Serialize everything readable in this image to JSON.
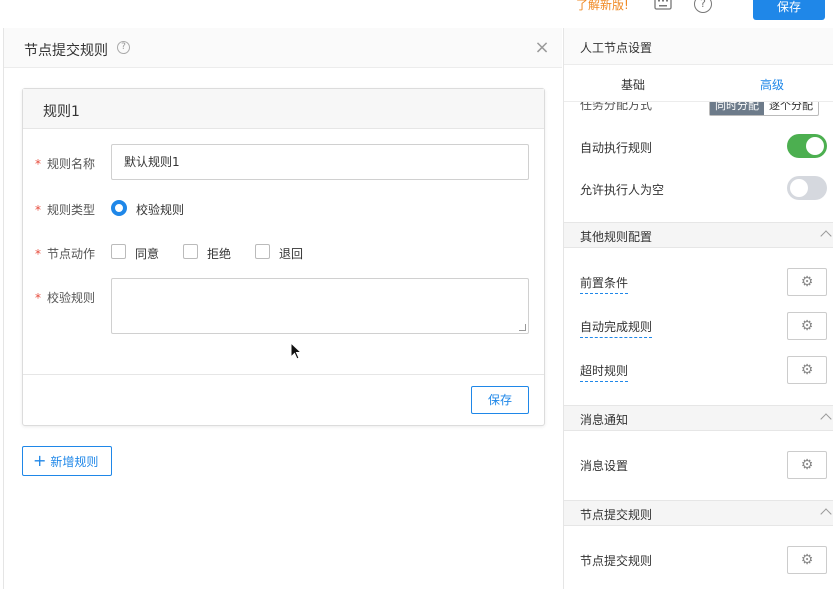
{
  "topbar": {
    "whats_new": "了解新版!",
    "save_label": "保存"
  },
  "dialog": {
    "title": "节点提交规则",
    "rule_card": {
      "title": "规则1",
      "fields": {
        "name_label": "规则名称",
        "name_value": "默认规则1",
        "type_label": "规则类型",
        "type_option": "校验规则",
        "action_label": "节点动作",
        "actions": [
          "同意",
          "拒绝",
          "退回"
        ],
        "check_label": "校验规则",
        "check_value": ""
      },
      "save_label": "保存"
    },
    "add_rule_label": "新增规则"
  },
  "right_panel": {
    "title": "人工节点设置",
    "tabs": [
      "基础",
      "高级"
    ],
    "active_tab": "高级",
    "partial_row": {
      "label": "任务分配方式",
      "options": [
        "同时分配",
        "逐个分配"
      ]
    },
    "toggles": [
      {
        "label": "自动执行规则",
        "on": true
      },
      {
        "label": "允许执行人为空",
        "on": false
      }
    ],
    "sections": [
      {
        "title": "其他规则配置",
        "items": [
          "前置条件",
          "自动完成规则",
          "超时规则"
        ]
      },
      {
        "title": "消息通知",
        "items": [
          "消息设置"
        ]
      },
      {
        "title": "节点提交规则",
        "items": [
          "节点提交规则"
        ]
      }
    ]
  },
  "colors": {
    "accent": "#1f87e8",
    "toggle_on": "#4caf50",
    "required": "#e74c3c",
    "whats_new": "#f08a24"
  }
}
